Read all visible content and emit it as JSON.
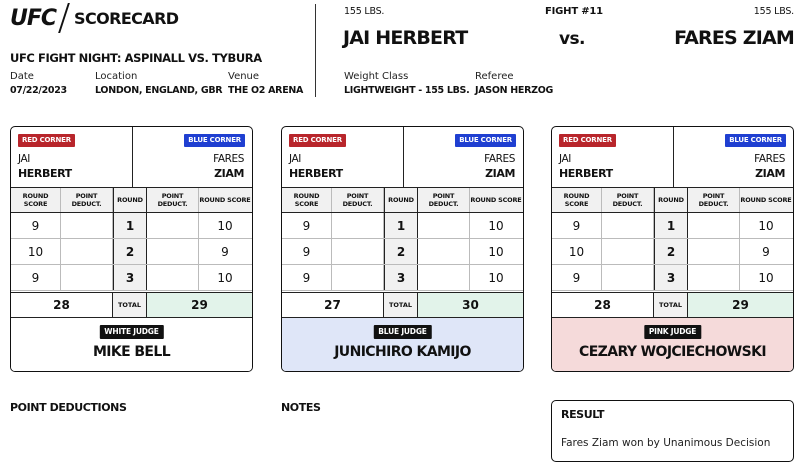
{
  "header": {
    "logo_text": "UFC",
    "scorecard_label": "SCORECARD",
    "event_title": "UFC FIGHT NIGHT: ASPINALL VS. TYBURA",
    "date_label": "Date",
    "date_value": "07/22/2023",
    "location_label": "Location",
    "location_value": "LONDON, ENGLAND, GBR",
    "venue_label": "Venue",
    "venue_value": "THE O2 ARENA",
    "weight_class_label": "Weight Class",
    "weight_class_value": "LIGHTWEIGHT - 155 LBS.",
    "referee_label": "Referee",
    "referee_value": "JASON HERZOG",
    "fight_number": "FIGHT #11",
    "red_weight": "155 LBS.",
    "blue_weight": "155 LBS.",
    "red_fighter": "JAI HERBERT",
    "blue_fighter": "FARES ZIAM",
    "vs": "vs."
  },
  "card_labels": {
    "red_corner": "RED CORNER",
    "blue_corner": "BLUE CORNER",
    "red_first": "JAI",
    "red_last": "HERBERT",
    "blue_first": "FARES",
    "blue_last": "ZIAM",
    "col_round_score": "ROUND SCORE",
    "col_point_deduct": "POINT DEDUCT.",
    "col_round": "ROUND",
    "total": "TOTAL"
  },
  "judges": [
    {
      "badge": "WHITE JUDGE",
      "name": "MIKE BELL",
      "bg": "#ffffff",
      "rounds": [
        {
          "round": "1",
          "red": "9",
          "red_ded": "",
          "blue_ded": "",
          "blue": "10"
        },
        {
          "round": "2",
          "red": "10",
          "red_ded": "",
          "blue_ded": "",
          "blue": "9"
        },
        {
          "round": "3",
          "red": "9",
          "red_ded": "",
          "blue_ded": "",
          "blue": "10"
        }
      ],
      "red_total": "28",
      "blue_total": "29"
    },
    {
      "badge": "BLUE JUDGE",
      "name": "JUNICHIRO KAMIJO",
      "bg": "#dfe6f8",
      "rounds": [
        {
          "round": "1",
          "red": "9",
          "red_ded": "",
          "blue_ded": "",
          "blue": "10"
        },
        {
          "round": "2",
          "red": "9",
          "red_ded": "",
          "blue_ded": "",
          "blue": "10"
        },
        {
          "round": "3",
          "red": "9",
          "red_ded": "",
          "blue_ded": "",
          "blue": "10"
        }
      ],
      "red_total": "27",
      "blue_total": "30"
    },
    {
      "badge": "PINK JUDGE",
      "name": "CEZARY WOJCIECHOWSKI",
      "bg": "#f5dada",
      "rounds": [
        {
          "round": "1",
          "red": "9",
          "red_ded": "",
          "blue_ded": "",
          "blue": "10"
        },
        {
          "round": "2",
          "red": "10",
          "red_ded": "",
          "blue_ded": "",
          "blue": "9"
        },
        {
          "round": "3",
          "red": "9",
          "red_ded": "",
          "blue_ded": "",
          "blue": "10"
        }
      ],
      "red_total": "28",
      "blue_total": "29"
    }
  ],
  "footer": {
    "point_deductions_label": "POINT DEDUCTIONS",
    "notes_label": "NOTES",
    "result_label": "RESULT",
    "result_text": "Fares Ziam won by Unanimous Decision"
  }
}
